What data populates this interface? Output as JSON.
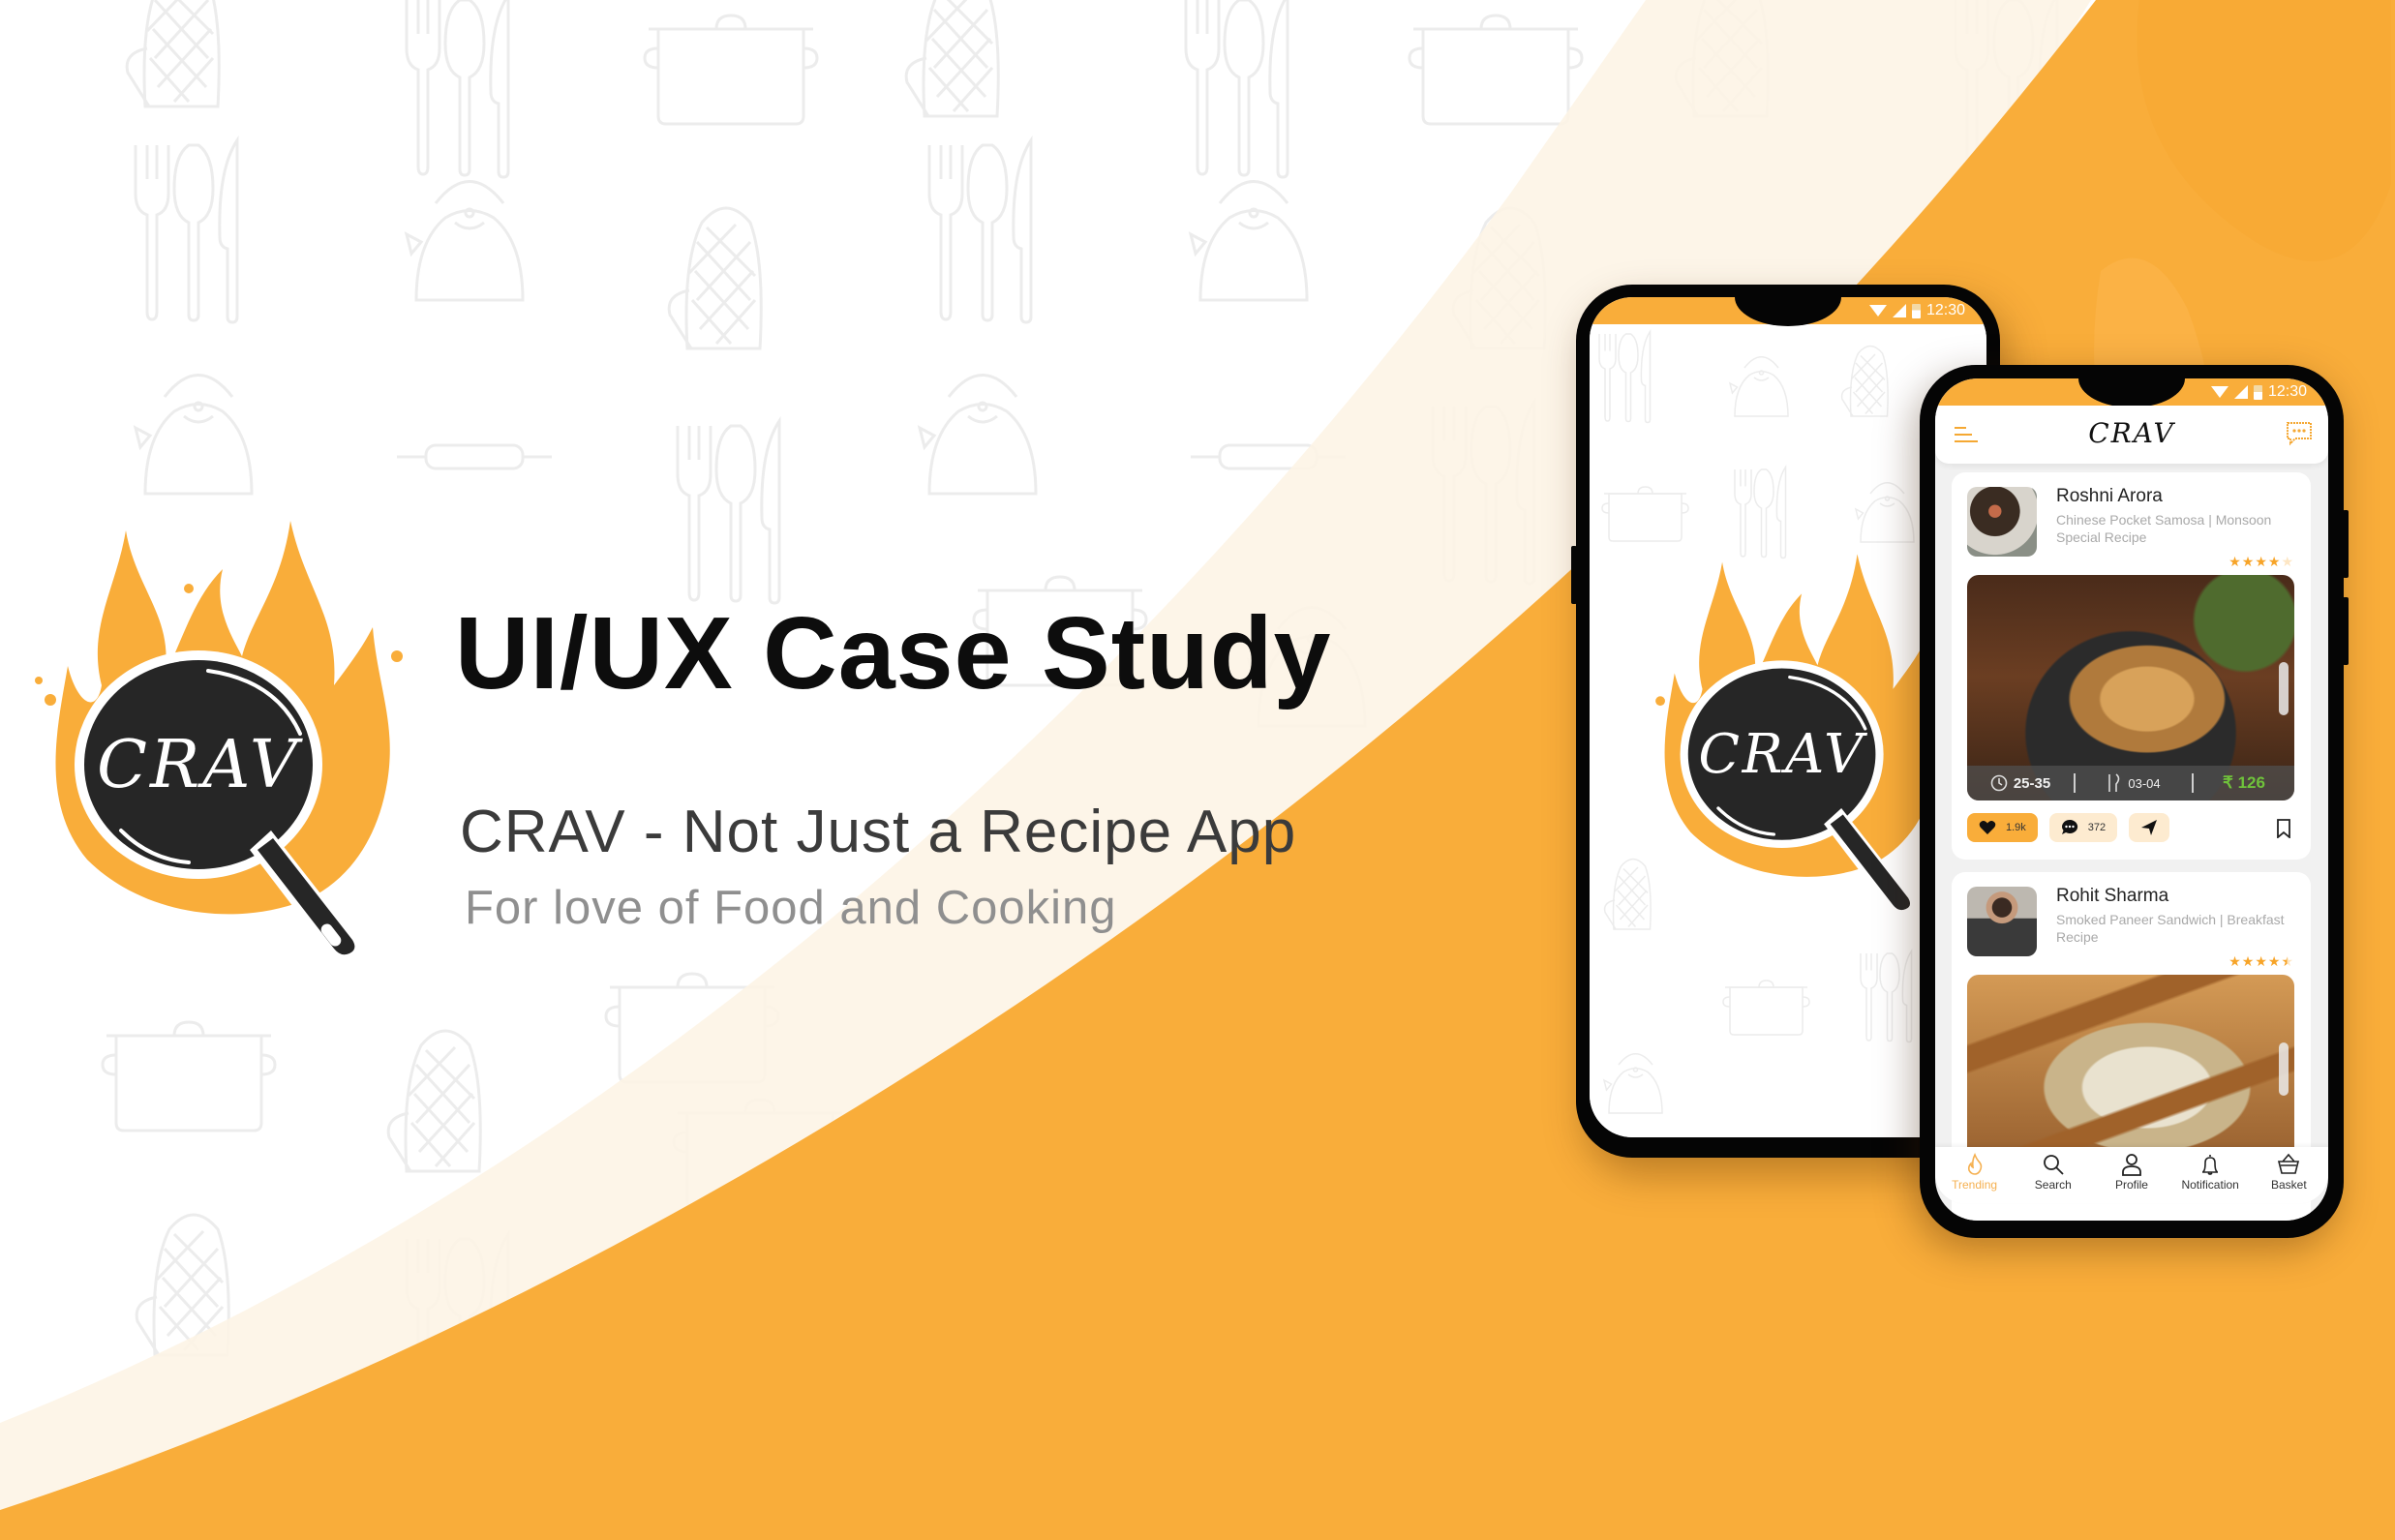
{
  "hero": {
    "title": "UI/UX Case Study",
    "subtitle": "CRAV - Not Just a Recipe App",
    "tagline": "For love of Food and Cooking",
    "logo_text": "CRAV"
  },
  "colors": {
    "brand_orange": "#f9ad3a",
    "logo_dark": "#262626",
    "price_green": "#6fc23b",
    "background": "#ffffff"
  },
  "status_bar": {
    "time": "12:30"
  },
  "splash_screen": {
    "logo_text": "CRAV"
  },
  "app": {
    "brand": "CRAV",
    "header": {
      "menu_icon": "menu-icon",
      "chat_icon": "chat-icon"
    },
    "feed": [
      {
        "author": "Roshni Arora",
        "recipe": "Chinese Pocket Samosa | Monsoon Special Recipe",
        "rating": 4,
        "rating_max": 5,
        "time": "25-35",
        "servings": "03-04",
        "price": "₹ 126",
        "likes": "1.9k",
        "comments": "372",
        "photo_desc": "Chinese pocket samosas on a tray"
      },
      {
        "author": "Rohit Sharma",
        "recipe": "Smoked Paneer Sandwich | Breakfast Recipe",
        "rating": 4.5,
        "rating_max": 5,
        "photo_desc": "Smoked paneer sandwich"
      }
    ],
    "bottom_nav": [
      {
        "label": "Trending",
        "icon": "flame-icon",
        "active": true
      },
      {
        "label": "Search",
        "icon": "search-icon",
        "active": false
      },
      {
        "label": "Profile",
        "icon": "profile-icon",
        "active": false
      },
      {
        "label": "Notification",
        "icon": "bell-icon",
        "active": false
      },
      {
        "label": "Basket",
        "icon": "basket-icon",
        "active": false
      }
    ]
  }
}
